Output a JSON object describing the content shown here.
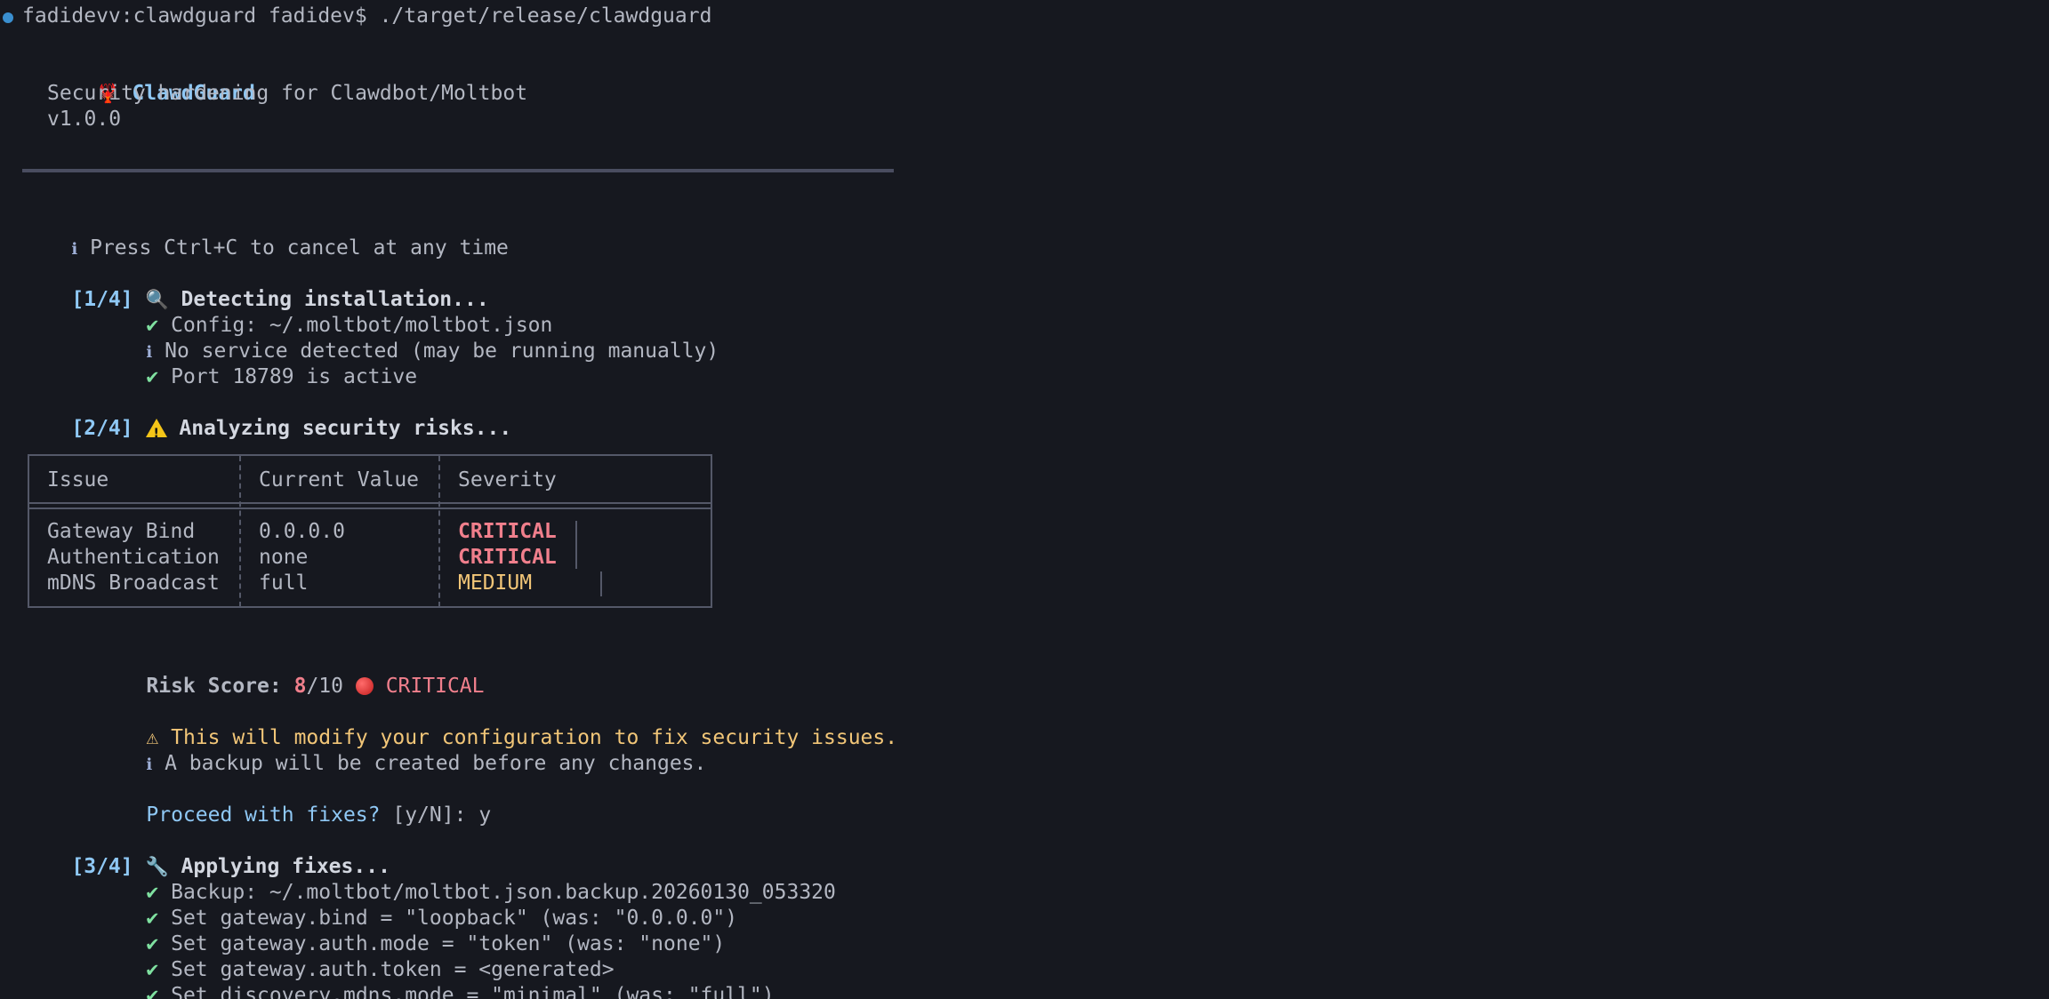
{
  "prompt": {
    "text": "fadidevv:clawdguard fadidev$ ./target/release/clawdguard"
  },
  "banner": {
    "title": "ClawdGuard",
    "subtitle": "Security hardening for Clawdbot/Moltbot",
    "version": "v1.0.0"
  },
  "hint": "Press Ctrl+C to cancel at any time",
  "step1": {
    "tag": "[1/4]",
    "title": "Detecting installation...",
    "lines": [
      {
        "icon": "check",
        "text": "Config: ~/.moltbot/moltbot.json"
      },
      {
        "icon": "info",
        "text": "No service detected (may be running manually)"
      },
      {
        "icon": "check",
        "text": "Port 18789 is active"
      }
    ]
  },
  "step2": {
    "tag": "[2/4]",
    "title": "Analyzing security risks..."
  },
  "table": {
    "headers": [
      "Issue",
      "Current Value",
      "Severity"
    ],
    "rows": [
      {
        "issue": "Gateway Bind",
        "value": "0.0.0.0",
        "severity": "CRITICAL"
      },
      {
        "issue": "Authentication",
        "value": "none",
        "severity": "CRITICAL"
      },
      {
        "issue": "mDNS Broadcast",
        "value": "full",
        "severity": "MEDIUM"
      }
    ]
  },
  "risk": {
    "label": "Risk Score:",
    "score": "8",
    "max": "/10",
    "level": "CRITICAL"
  },
  "notices": {
    "warning": "This will modify your configuration to fix security issues.",
    "info": "A backup will be created before any changes."
  },
  "confirm": {
    "question": "Proceed with fixes?",
    "options": "[y/N]:",
    "answer": "y"
  },
  "step3": {
    "tag": "[3/4]",
    "title": "Applying fixes...",
    "lines": [
      "Backup: ~/.moltbot/moltbot.json.backup.20260130_053320",
      "Set gateway.bind = \"loopback\" (was: \"0.0.0.0\")",
      "Set gateway.auth.mode = \"token\" (was: \"none\")",
      "Set gateway.auth.token = <generated>",
      "Set discovery.mdns.mode = \"minimal\" (was: \"full\")"
    ]
  },
  "glyphs": {
    "check": "✔",
    "info": "ℹ",
    "warn": "⚠",
    "lobster": "🦞",
    "magnifier": "🔍",
    "wrench": "🔧"
  },
  "colors": {
    "background": "#16181f",
    "accent_blue": "#8fc8f5",
    "success_green": "#7fe0a0",
    "critical_red": "#f07f8c",
    "warning_yellow": "#f2c678"
  }
}
